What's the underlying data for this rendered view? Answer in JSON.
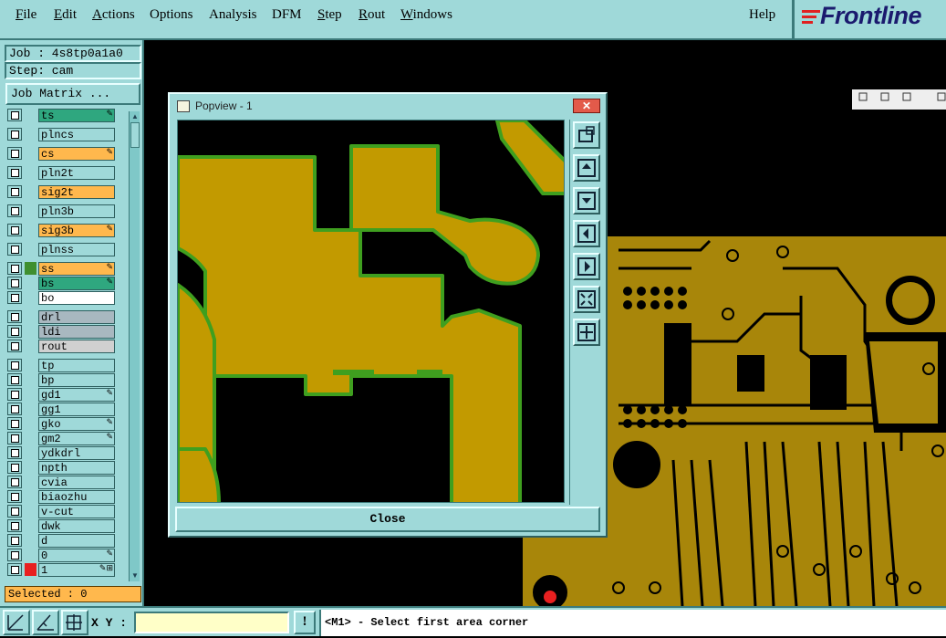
{
  "menubar": {
    "items": [
      {
        "label": "File"
      },
      {
        "label": "Edit"
      },
      {
        "label": "Actions"
      },
      {
        "label": "Options"
      },
      {
        "label": "Analysis"
      },
      {
        "label": "DFM"
      },
      {
        "label": "Step"
      },
      {
        "label": "Rout"
      },
      {
        "label": "Windows"
      }
    ],
    "help": "Help",
    "brand": "Frontline"
  },
  "left_panel": {
    "job": "Job : 4s8tp0a1a0",
    "step": "Step: cam",
    "job_matrix": "Job Matrix ...",
    "selected": "Selected : 0",
    "layers": [
      {
        "name": "ts",
        "color": "#2fa77f",
        "swatch": "",
        "flag": "✎"
      },
      {
        "name": "plncs",
        "color": "#9fd9d9",
        "swatch": "",
        "flag": ""
      },
      {
        "name": "cs",
        "color": "#ffb84d",
        "swatch": "",
        "flag": "✎"
      },
      {
        "name": "pln2t",
        "color": "#9fd9d9",
        "swatch": "",
        "flag": ""
      },
      {
        "name": "sig2t",
        "color": "#ffb84d",
        "swatch": "",
        "flag": ""
      },
      {
        "name": "pln3b",
        "color": "#9fd9d9",
        "swatch": "",
        "flag": ""
      },
      {
        "name": "sig3b",
        "color": "#ffb84d",
        "swatch": "",
        "flag": "✎"
      },
      {
        "name": "plnss",
        "color": "#9fd9d9",
        "swatch": "",
        "flag": ""
      },
      {
        "name": "ss",
        "color": "#ffb84d",
        "swatch": "#3f8f2f",
        "flag": "✎"
      },
      {
        "name": "bs",
        "color": "#2fa77f",
        "swatch": "",
        "flag": "✎"
      },
      {
        "name": "bo",
        "color": "#ffffff",
        "swatch": "",
        "flag": ""
      },
      {
        "name": "drl",
        "color": "#a8b8c0",
        "swatch": "",
        "flag": ""
      },
      {
        "name": "ldi",
        "color": "#a8b8c0",
        "swatch": "",
        "flag": ""
      },
      {
        "name": "rout",
        "color": "#d0d0d0",
        "swatch": "",
        "flag": ""
      },
      {
        "name": "tp",
        "color": "#9fd9d9",
        "swatch": "",
        "flag": ""
      },
      {
        "name": "bp",
        "color": "#9fd9d9",
        "swatch": "",
        "flag": ""
      },
      {
        "name": "gd1",
        "color": "#9fd9d9",
        "swatch": "",
        "flag": "✎"
      },
      {
        "name": "gg1",
        "color": "#9fd9d9",
        "swatch": "",
        "flag": ""
      },
      {
        "name": "gko",
        "color": "#9fd9d9",
        "swatch": "",
        "flag": "✎"
      },
      {
        "name": "gm2",
        "color": "#9fd9d9",
        "swatch": "",
        "flag": "✎"
      },
      {
        "name": "ydkdrl",
        "color": "#9fd9d9",
        "swatch": "",
        "flag": ""
      },
      {
        "name": "npth",
        "color": "#9fd9d9",
        "swatch": "",
        "flag": ""
      },
      {
        "name": "cvia",
        "color": "#9fd9d9",
        "swatch": "",
        "flag": ""
      },
      {
        "name": "biaozhu",
        "color": "#9fd9d9",
        "swatch": "",
        "flag": ""
      },
      {
        "name": "v-cut",
        "color": "#9fd9d9",
        "swatch": "",
        "flag": ""
      },
      {
        "name": "dwk",
        "color": "#9fd9d9",
        "swatch": "",
        "flag": ""
      },
      {
        "name": "d",
        "color": "#9fd9d9",
        "swatch": "",
        "flag": ""
      },
      {
        "name": "0",
        "color": "#9fd9d9",
        "swatch": "",
        "flag": "✎"
      },
      {
        "name": "1",
        "color": "#9fd9d9",
        "swatch": "#e82020",
        "flag": "✎⊞"
      }
    ]
  },
  "popview": {
    "title": "Popview - 1",
    "close_label": "Close",
    "tools": [
      "zoom-fit-icon",
      "pan-up-icon",
      "pan-down-icon",
      "pan-left-icon",
      "pan-right-icon",
      "zoom-out-icon",
      "zoom-in-icon"
    ]
  },
  "bottombar": {
    "xy_label": "X Y :",
    "xy_value": "",
    "warn": "!",
    "status": "<M1> - Select first area corner"
  },
  "colors": {
    "ui_teal": "#9fd9d9",
    "copper": "#c29a00",
    "outline_green": "#3f9f1f"
  }
}
